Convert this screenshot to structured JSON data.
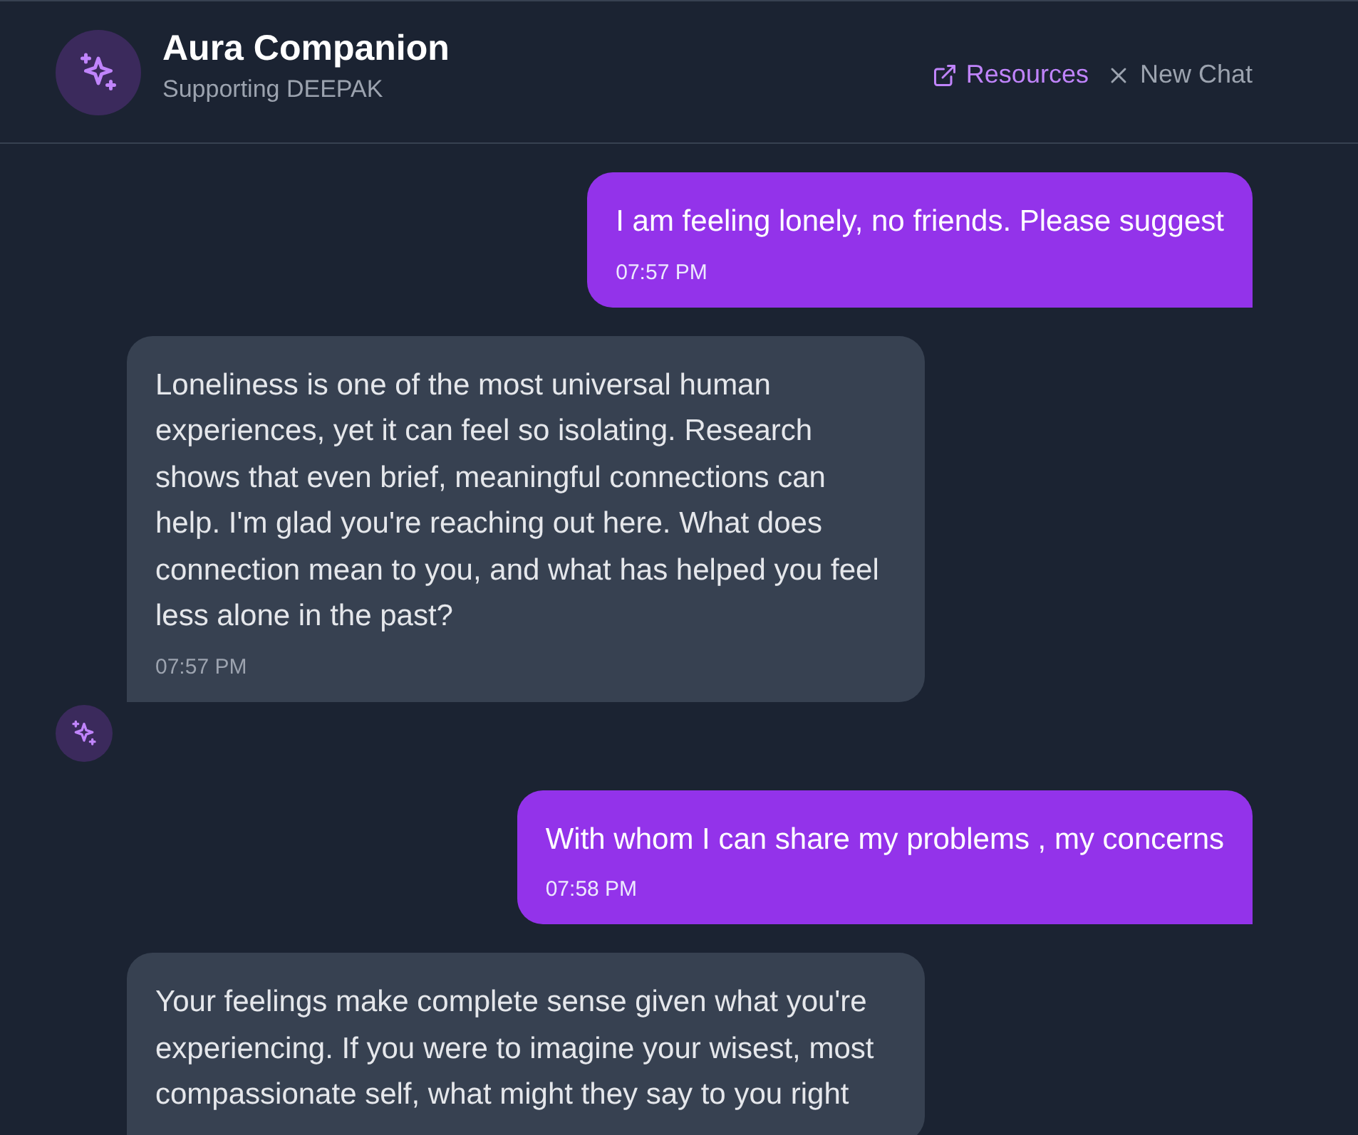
{
  "header": {
    "title": "Aura Companion",
    "subtitle": "Supporting DEEPAK",
    "actions": [
      {
        "kind": "external",
        "label": "Resources"
      },
      {
        "kind": "close",
        "label": "New Chat"
      }
    ]
  },
  "messages": [
    {
      "kind": "user",
      "text": "I am feeling lonely, no friends. Please suggest",
      "time": "07:57 PM",
      "show_avatar": false
    },
    {
      "kind": "assistant",
      "text": "Loneliness is one of the most universal human experiences, yet it can feel so isolating. Research shows that even brief, meaningful connections can help. I'm glad you're reaching out here. What does connection mean to you, and what has helped you feel less alone in the past?",
      "time": "07:57 PM",
      "show_avatar": true
    },
    {
      "kind": "user",
      "text": "With whom I can share my problems , my concerns",
      "time": "07:58 PM",
      "show_avatar": false
    },
    {
      "kind": "assistant",
      "text": "Your feelings make complete sense given what you're experiencing. If you were to imagine your wisest, most compassionate self, what might they say to you right",
      "show_avatar": false
    }
  ]
}
